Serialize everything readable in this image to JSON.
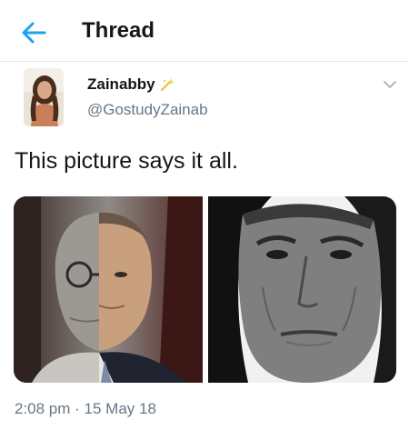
{
  "header": {
    "title": "Thread",
    "back_icon": "arrow-left-icon",
    "accent_color": "#1da1f2"
  },
  "tweet": {
    "display_name": "Zainabby",
    "handle": "@GostudyZainab",
    "text": "This picture says it all.",
    "timestamp": "2:08 pm · 15 May 18",
    "badge_icon": "sparkle-badge-icon",
    "menu_icon": "chevron-down-icon"
  },
  "colors": {
    "text_primary": "#14171a",
    "text_secondary": "#657786",
    "divider": "#e1e8ed"
  }
}
